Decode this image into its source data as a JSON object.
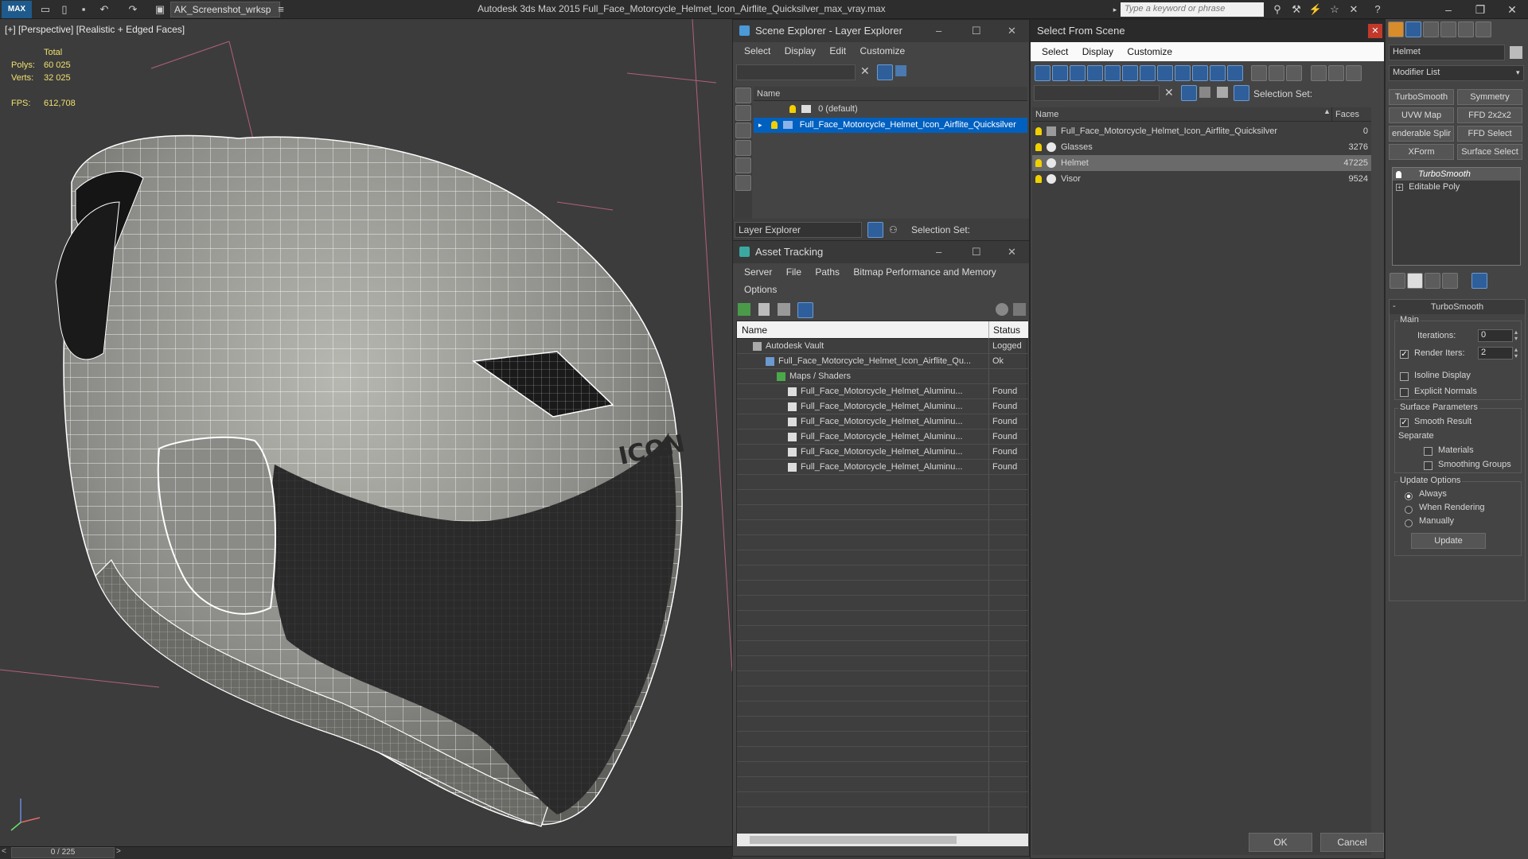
{
  "titlebar": {
    "logo": "MAX",
    "workspace": "AK_Screenshot_wrksp",
    "app_title": "Autodesk 3ds Max  2015     Full_Face_Motorcycle_Helmet_Icon_Airflite_Quicksilver_max_vray.max",
    "search_placeholder": "Type a keyword or phrase"
  },
  "viewport": {
    "label": "[+] [Perspective] [Realistic + Edged Faces]",
    "total_label": "Total",
    "polys_label": "Polys:",
    "polys_value": "60 025",
    "verts_label": "Verts:",
    "verts_value": "32 025",
    "fps_label": "FPS:",
    "fps_value": "612,708",
    "logo_text": "ICON"
  },
  "timeline": {
    "frame": "0 / 225"
  },
  "scene_explorer": {
    "title": "Scene Explorer - Layer Explorer",
    "menu": [
      "Select",
      "Display",
      "Edit",
      "Customize"
    ],
    "col_name": "Name",
    "rows": [
      "0 (default)",
      "Full_Face_Motorcycle_Helmet_Icon_Airflite_Quicksilver"
    ],
    "footer_dropdown": "Layer Explorer",
    "selection_set_label": "Selection Set:"
  },
  "asset_tracking": {
    "title": "Asset Tracking",
    "menu": [
      "Server",
      "File",
      "Paths",
      "Bitmap Performance and Memory"
    ],
    "menu2": "Options",
    "col_name": "Name",
    "col_status": "Status",
    "rows": [
      {
        "name": "Autodesk Vault",
        "status": "Logged"
      },
      {
        "name": "Full_Face_Motorcycle_Helmet_Icon_Airflite_Qu...",
        "status": "Ok"
      },
      {
        "name": "Maps / Shaders",
        "status": ""
      },
      {
        "name": "Full_Face_Motorcycle_Helmet_Aluminu...",
        "status": "Found"
      },
      {
        "name": "Full_Face_Motorcycle_Helmet_Aluminu...",
        "status": "Found"
      },
      {
        "name": "Full_Face_Motorcycle_Helmet_Aluminu...",
        "status": "Found"
      },
      {
        "name": "Full_Face_Motorcycle_Helmet_Aluminu...",
        "status": "Found"
      },
      {
        "name": "Full_Face_Motorcycle_Helmet_Aluminu...",
        "status": "Found"
      },
      {
        "name": "Full_Face_Motorcycle_Helmet_Aluminu...",
        "status": "Found"
      }
    ]
  },
  "select_from_scene": {
    "title": "Select From Scene",
    "menu": [
      "Select",
      "Display",
      "Customize"
    ],
    "selection_set_label": "Selection Set:",
    "col_name": "Name",
    "col_faces": "Faces",
    "rows": [
      {
        "name": "Full_Face_Motorcycle_Helmet_Icon_Airflite_Quicksilver",
        "faces": "0"
      },
      {
        "name": "Glasses",
        "faces": "3276"
      },
      {
        "name": "Helmet",
        "faces": "47225"
      },
      {
        "name": "Visor",
        "faces": "9524"
      }
    ],
    "ok": "OK",
    "cancel": "Cancel"
  },
  "command_panel": {
    "object_name": "Helmet",
    "modifier_list": "Modifier List",
    "buttons": [
      "TurboSmooth",
      "Symmetry",
      "UVW Map",
      "FFD 2x2x2",
      "enderable Splir",
      "FFD Select",
      "XForm",
      "Surface Select"
    ],
    "stack": [
      "TurboSmooth",
      "Editable Poly"
    ],
    "rollout_title": "TurboSmooth",
    "main_label": "Main",
    "iterations_label": "Iterations:",
    "iterations_value": "0",
    "render_iters_label": "Render Iters:",
    "render_iters_value": "2",
    "isoline": "Isoline Display",
    "explicit_normals": "Explicit Normals",
    "surface_params": "Surface Parameters",
    "smooth_result": "Smooth Result",
    "separate": "Separate",
    "materials": "Materials",
    "smoothing_groups": "Smoothing Groups",
    "update_options": "Update Options",
    "always": "Always",
    "when_rendering": "When Rendering",
    "manually": "Manually",
    "update_btn": "Update"
  }
}
